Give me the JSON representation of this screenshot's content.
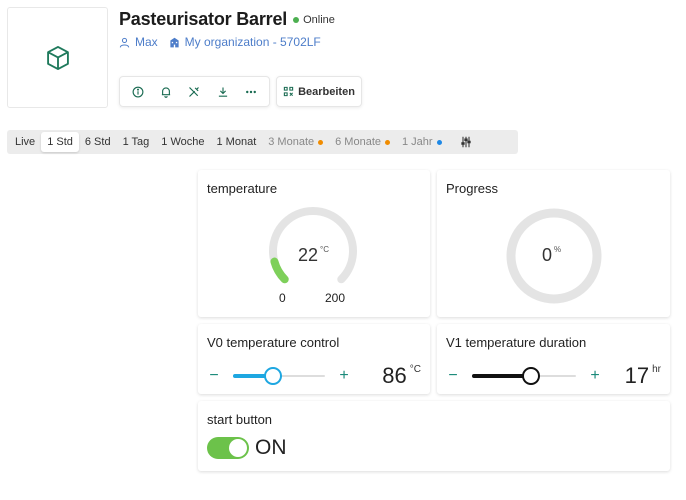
{
  "device": {
    "title": "Pasteurisator Barrel",
    "status": "Online",
    "status_color": "#4caf50",
    "thumbnail_icon": "cube-icon",
    "user": "Max",
    "organization": "My organization - 5702LF"
  },
  "actions": {
    "icons": [
      "info-icon",
      "bell-icon",
      "tools-icon",
      "download-icon",
      "more-icon"
    ],
    "edit_label": "Bearbeiten"
  },
  "time_range": {
    "selected": "1 Std",
    "items": [
      {
        "label": "Live",
        "dim": false,
        "dot": ""
      },
      {
        "label": "1 Std",
        "dim": false,
        "dot": ""
      },
      {
        "label": "6 Std",
        "dim": false,
        "dot": ""
      },
      {
        "label": "1 Tag",
        "dim": false,
        "dot": ""
      },
      {
        "label": "1 Woche",
        "dim": false,
        "dot": ""
      },
      {
        "label": "1 Monat",
        "dim": false,
        "dot": ""
      },
      {
        "label": "3 Monate",
        "dim": true,
        "dot": "#f08c00"
      },
      {
        "label": "6 Monate",
        "dim": true,
        "dot": "#f08c00"
      },
      {
        "label": "1 Jahr",
        "dim": true,
        "dot": "#1e88e5"
      }
    ]
  },
  "widgets": {
    "temperature": {
      "title": "temperature",
      "value": "22",
      "unit": "°C",
      "min": "0",
      "max": "200",
      "fraction": 0.11,
      "color": "#7ed05a"
    },
    "progress": {
      "title": "Progress",
      "value": "0",
      "unit": "%",
      "fraction": 0
    },
    "v0": {
      "title": "V0 temperature control",
      "minus": "−",
      "plus": "+",
      "value": "86",
      "unit": "°C",
      "fraction": 0.43,
      "color": "#1ea7e1"
    },
    "v1": {
      "title": "V1 temperature duration",
      "minus": "−",
      "plus": "+",
      "value": "17",
      "unit": "hr",
      "fraction": 0.57,
      "color": "#111111"
    },
    "start": {
      "title": "start button",
      "state": "ON",
      "on": true,
      "color": "#6cc24a"
    }
  }
}
